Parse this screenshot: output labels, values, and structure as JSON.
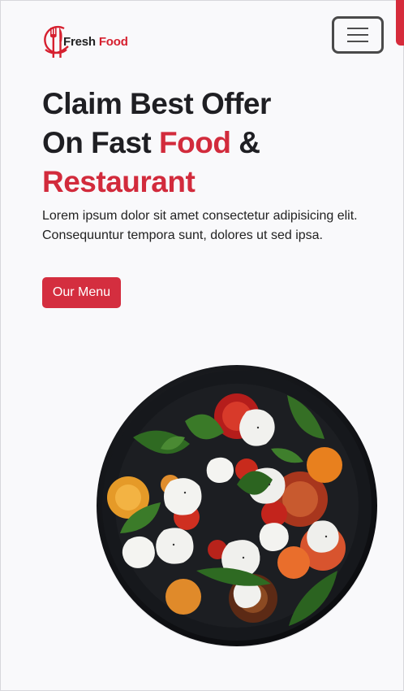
{
  "brand": {
    "word1": "Fresh",
    "word2": "Food"
  },
  "navbar": {
    "toggler_icon": "hamburger-icon"
  },
  "hero": {
    "title_line1": "Claim Best Offer",
    "title_line2_start": "On Fast ",
    "title_line2_accent": "Food",
    "title_line2_end": " &",
    "title_line3": "Restaurant",
    "text": "Lorem ipsum dolor sit amet consectetur adipisicing elit. Consequuntur tempora sunt, dolores ut sed ipsa.",
    "button_label": "Our Menu"
  },
  "colors": {
    "accent": "#d42e3f",
    "text": "#1f1f23",
    "background": "#f9f9fb"
  }
}
